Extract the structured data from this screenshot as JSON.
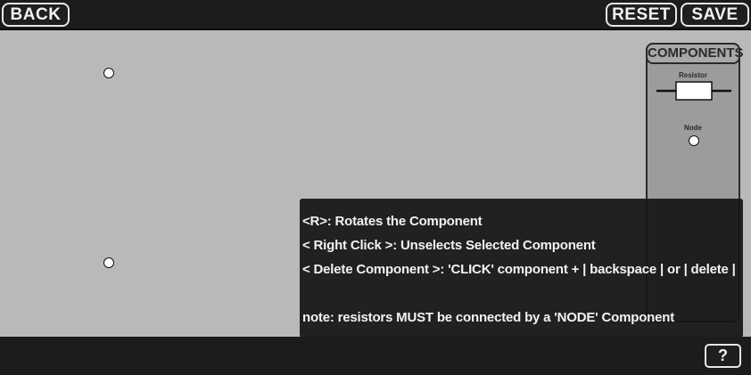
{
  "toolbar": {
    "back_label": "BACK",
    "reset_label": "RESET",
    "save_label": "SAVE"
  },
  "components_panel": {
    "title": "COMPONENTS",
    "items": [
      {
        "label": "Resistor",
        "icon": "resistor-icon"
      },
      {
        "label": "Node",
        "icon": "node-icon"
      }
    ]
  },
  "help": {
    "lines": [
      "<R>: Rotates the Component",
      "< Right Click >: Unselects Selected Component",
      "< Delete Component >: 'CLICK' component + | backspace | or | delete |",
      "note: resistors MUST be connected by a 'NODE' Component"
    ]
  },
  "help_button_label": "?",
  "colors": {
    "canvas": "#b9b9b9",
    "bar": "#1c1c1c",
    "button_border": "#e8e8e8",
    "panel": "#9c9c9c"
  }
}
